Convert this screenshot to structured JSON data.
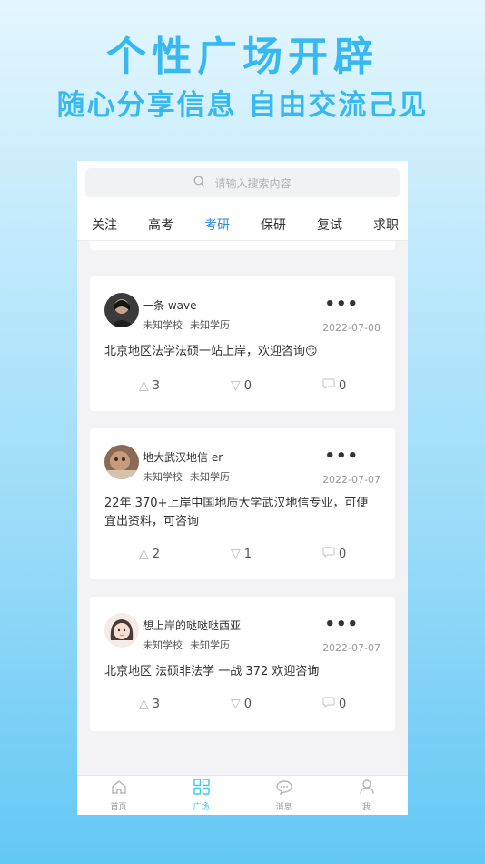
{
  "hero": {
    "title": "个性广场开辟",
    "subtitle": "随心分享信息 自由交流己见"
  },
  "search": {
    "placeholder": "请输入搜索内容"
  },
  "tabs": [
    {
      "label": "关注"
    },
    {
      "label": "高考"
    },
    {
      "label": "考研",
      "active": true
    },
    {
      "label": "保研"
    },
    {
      "label": "复试"
    },
    {
      "label": "求职"
    }
  ],
  "posts": [
    {
      "name": "一条 wave",
      "school": "未知学校",
      "edu": "未知学历",
      "date": "2022-07-08",
      "text": "北京地区法学法硕一站上岸，欢迎咨询😏",
      "likes": "3",
      "dislikes": "0",
      "comments": "0"
    },
    {
      "name": "地大武汉地信 er",
      "school": "未知学校",
      "edu": "未知学历",
      "date": "2022-07-07",
      "text": "22年 370+上岸中国地质大学武汉地信专业，可便宜出资料，可咨询",
      "likes": "2",
      "dislikes": "1",
      "comments": "0"
    },
    {
      "name": "想上岸的哒哒哒西亚",
      "school": "未知学校",
      "edu": "未知学历",
      "date": "2022-07-07",
      "text": "北京地区 法硕非法学 一战 372 欢迎咨询",
      "likes": "3",
      "dislikes": "0",
      "comments": "0"
    }
  ],
  "more_label": "•••",
  "fab_label": "+",
  "bottom_nav": [
    {
      "label": "首页",
      "icon": "home-icon"
    },
    {
      "label": "广场",
      "icon": "grid-icon",
      "active": true
    },
    {
      "label": "消息",
      "icon": "message-icon"
    },
    {
      "label": "我",
      "icon": "user-icon"
    }
  ],
  "colors": {
    "accent": "#36b9f0",
    "tab_active": "#2f8ad8",
    "fab": "#3fc9e4"
  }
}
